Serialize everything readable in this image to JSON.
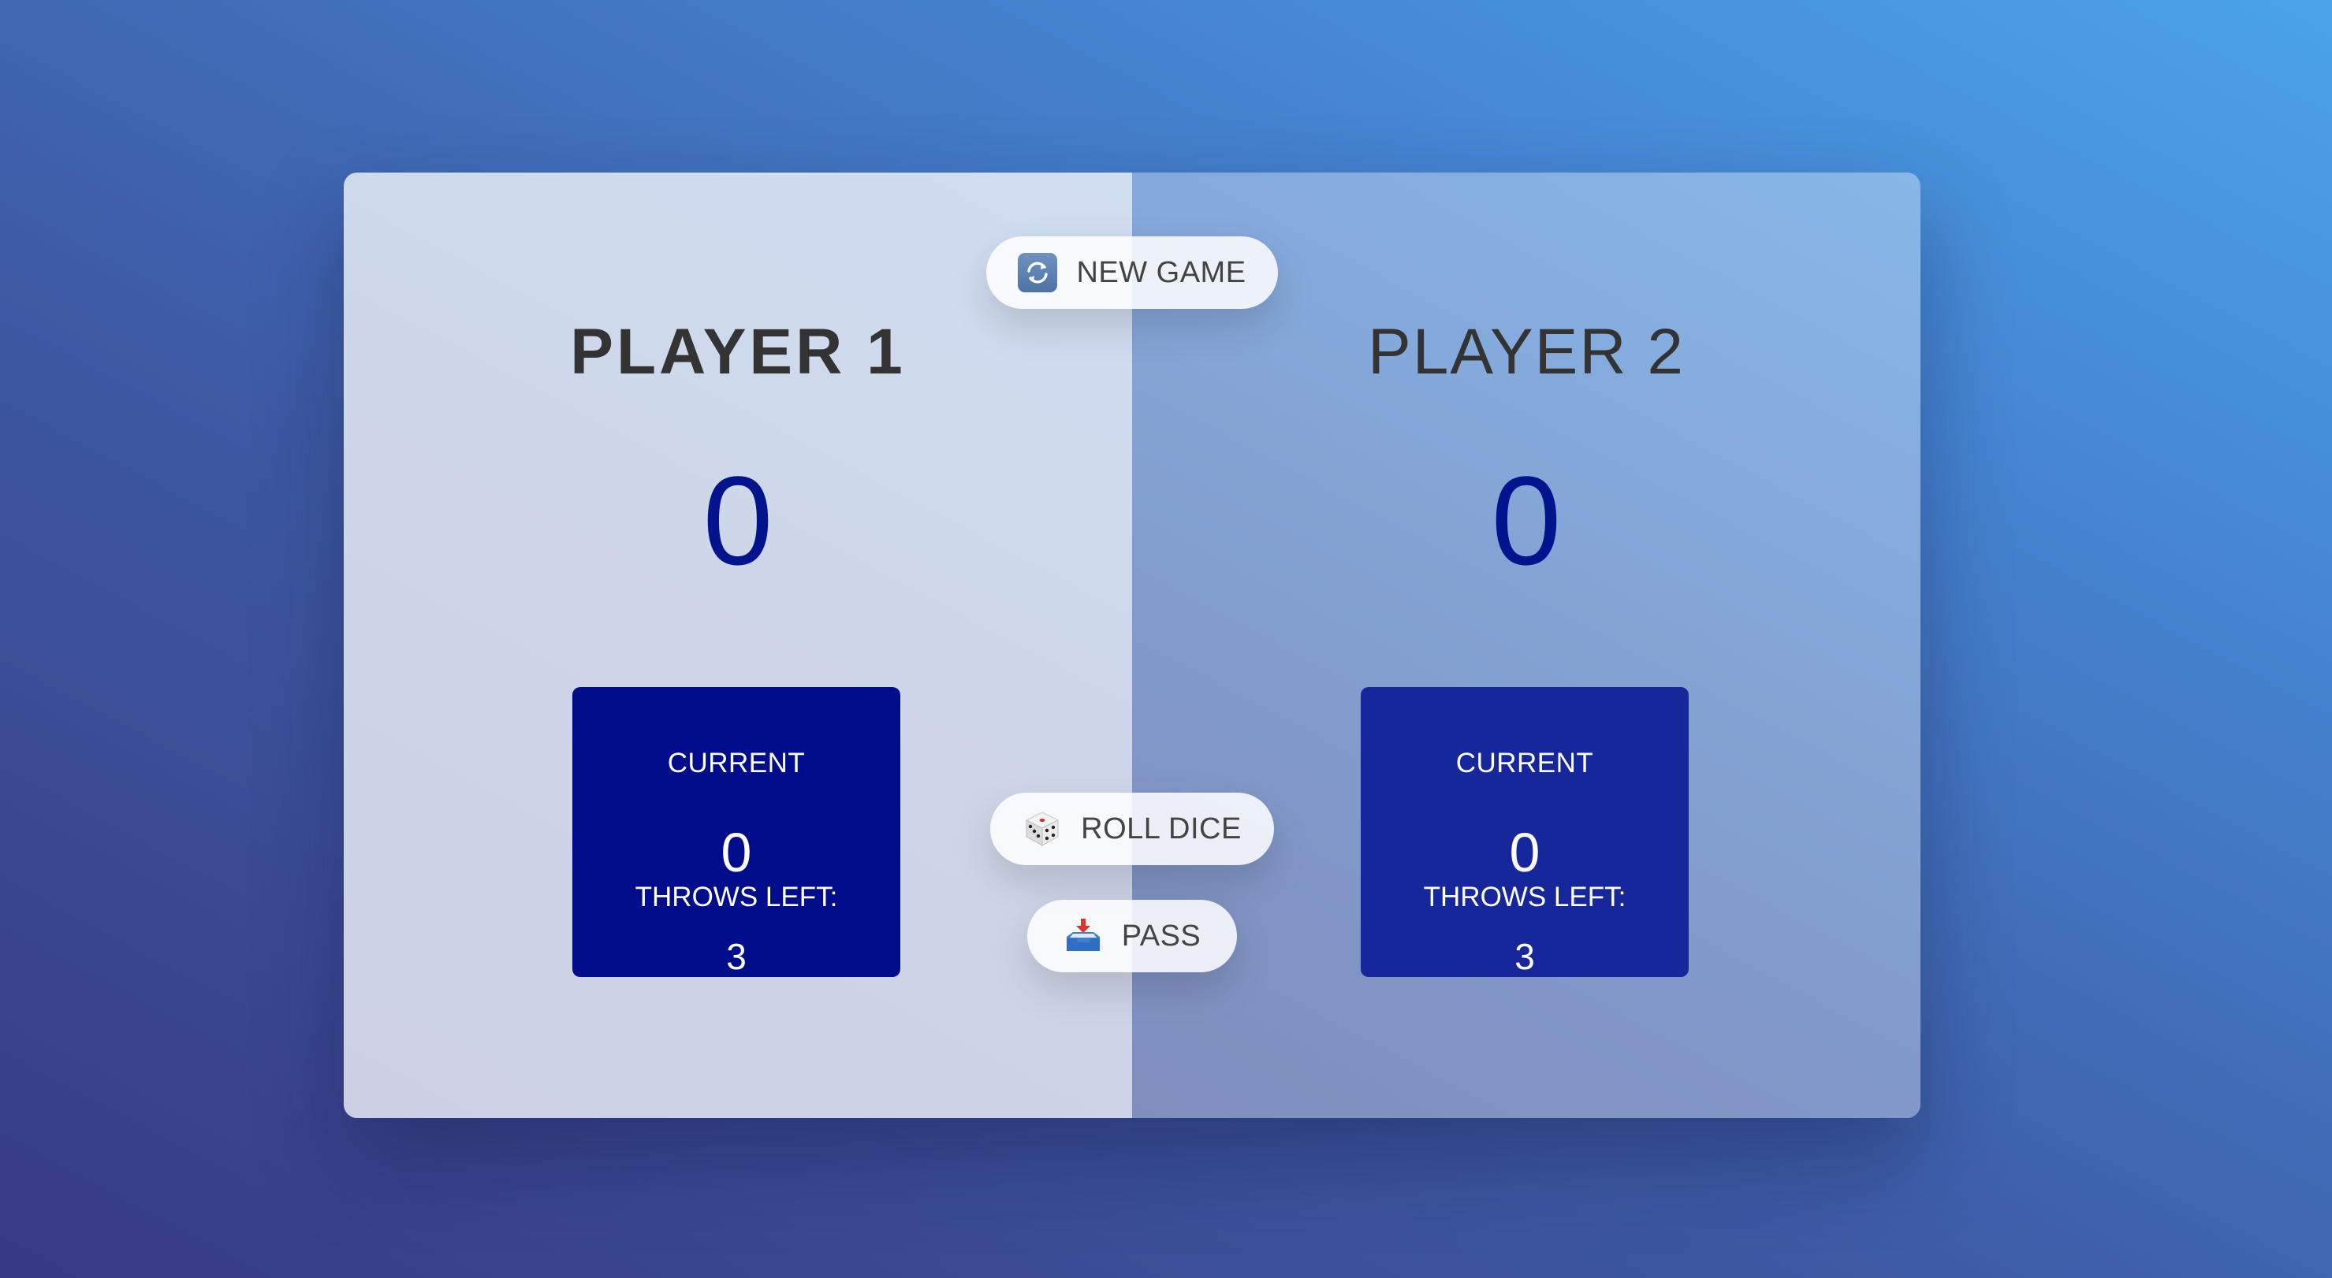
{
  "players": [
    {
      "name": "PLAYER 1",
      "score": "0",
      "current_label": "CURRENT",
      "current_score": "0",
      "throws_label": "THROWS LEFT:",
      "throws_left": "3",
      "active": true
    },
    {
      "name": "PLAYER 2",
      "score": "0",
      "current_label": "CURRENT",
      "current_score": "0",
      "throws_label": "THROWS LEFT:",
      "throws_left": "3",
      "active": false
    }
  ],
  "buttons": {
    "new_game": {
      "label": "NEW GAME",
      "icon": "refresh-icon"
    },
    "roll_dice": {
      "label": "ROLL DICE",
      "icon": "dice-icon"
    },
    "pass": {
      "label": "PASS",
      "icon": "inbox-tray-icon"
    }
  },
  "colors": {
    "score": "#01138d",
    "current_box_active": "#000d8a",
    "current_box_inactive": "#16279c",
    "name_text": "#333333"
  }
}
